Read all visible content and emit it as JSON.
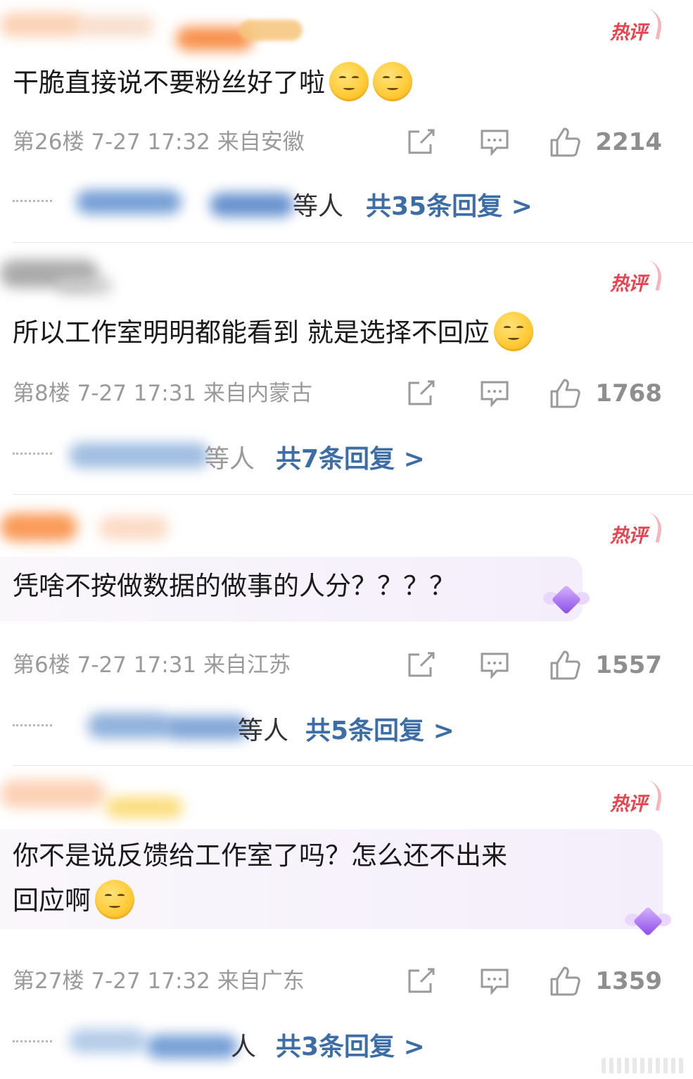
{
  "hot_label": "热评",
  "comments": [
    {
      "content": "干脆直接说不要粉丝好了啦",
      "floor": "第26楼",
      "time": "7-27 17:32",
      "location": "来自安徽",
      "likes": "2214",
      "reply_suffix": "等人",
      "reply_link": "共35条回复 >",
      "emojis": [
        "shushing-face-icon",
        "shushing-face-icon"
      ]
    },
    {
      "content": "所以工作室明明都能看到 就是选择不回应",
      "floor": "第8楼",
      "time": "7-27 17:31",
      "location": "来自内蒙古",
      "likes": "1768",
      "reply_suffix": "等人",
      "reply_link": "共7条回复 >",
      "emojis": [
        "melting-face-icon"
      ]
    },
    {
      "content": "凭啥不按做数据的做事的人分？？？？",
      "floor": "第6楼",
      "time": "7-27 17:31",
      "location": "来自江苏",
      "likes": "1557",
      "reply_suffix": "等人",
      "reply_link": "共5条回复 >",
      "emojis": []
    },
    {
      "content_line1": "你不是说反馈给工作室了吗？怎么还不出来",
      "content_line2": "回应啊",
      "floor": "第27楼",
      "time": "7-27 17:32",
      "location": "来自广东",
      "likes": "1359",
      "reply_suffix": "人",
      "reply_link": "共3条回复 >",
      "emojis": [
        "confused-face-icon"
      ]
    }
  ],
  "colors": {
    "hot": "#e8434f",
    "link": "#3d6da6",
    "meta": "#9a9a9a"
  }
}
